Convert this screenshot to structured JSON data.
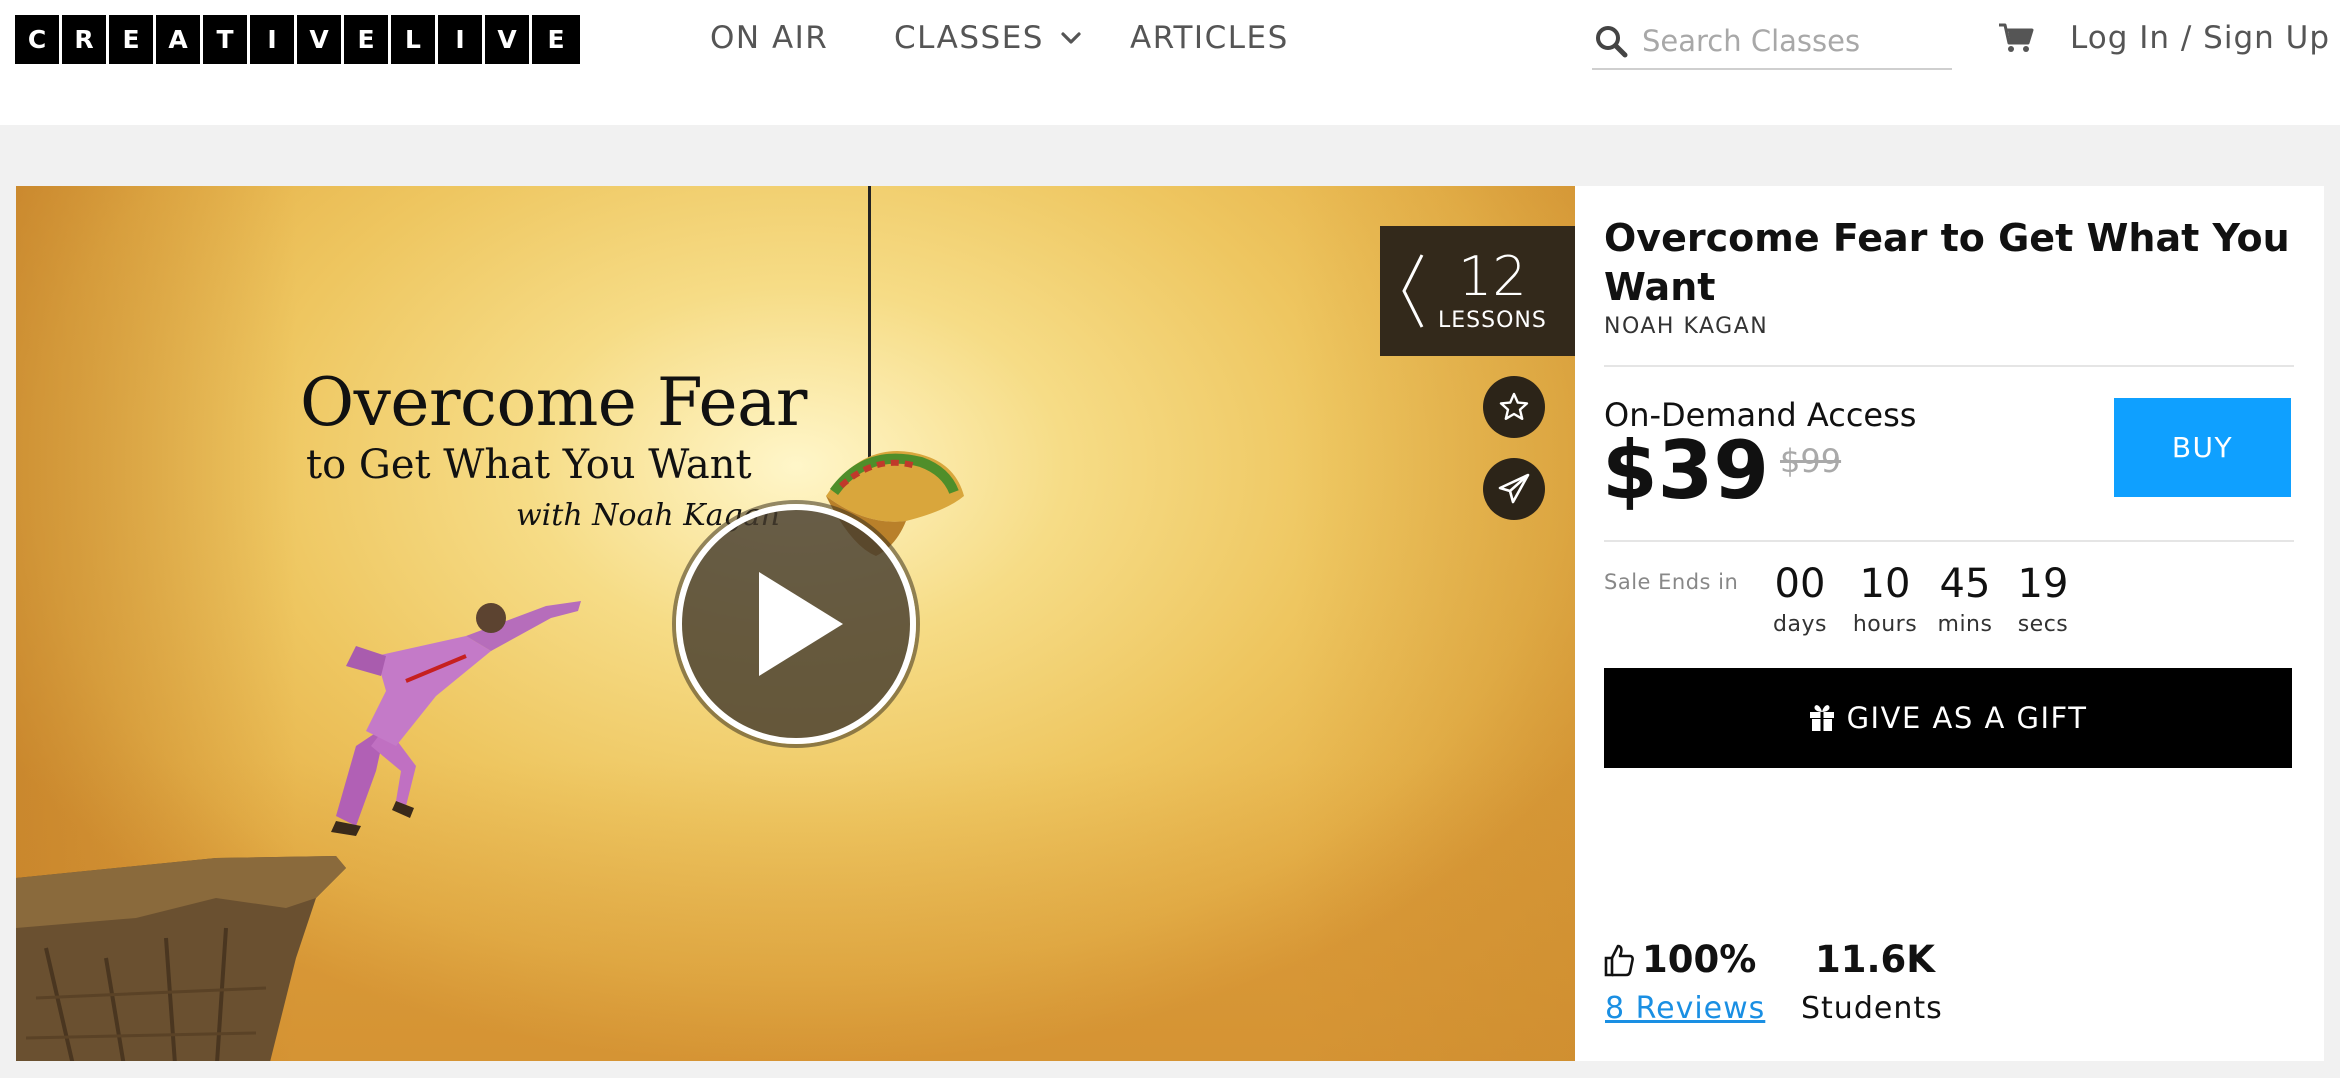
{
  "header": {
    "logo_letters": [
      "C",
      "R",
      "E",
      "A",
      "T",
      "I",
      "V",
      "E",
      "L",
      "I",
      "V",
      "E"
    ],
    "nav": {
      "on_air": "ON AIR",
      "classes": "CLASSES",
      "articles": "ARTICLES"
    },
    "search": {
      "placeholder": "Search Classes"
    },
    "login": "Log In / Sign Up"
  },
  "hero": {
    "title": "Overcome Fear",
    "subtitle": "to Get What You Want",
    "with": "with Noah Kagan",
    "lessons_count": "12",
    "lessons_label": "LESSONS"
  },
  "course": {
    "title": "Overcome Fear to Get What You Want",
    "author": "NOAH KAGAN",
    "access_label": "On-Demand Access",
    "price": "$39",
    "original_price": "$99",
    "buy_label": "BUY",
    "sale_ends_label": "Sale Ends in",
    "countdown": {
      "days": "00",
      "days_label": "days",
      "hours": "10",
      "hours_label": "hours",
      "mins": "45",
      "mins_label": "mins",
      "secs": "19",
      "secs_label": "secs"
    },
    "gift_label": "GIVE AS A GIFT",
    "rating_percent": "100%",
    "reviews_link": "8 Reviews",
    "students_count": "11.6K",
    "students_label": "Students"
  },
  "colors": {
    "buy_button": "#0fa0ff",
    "link": "#1a8fe3",
    "lessons_bg": "#33291b"
  }
}
